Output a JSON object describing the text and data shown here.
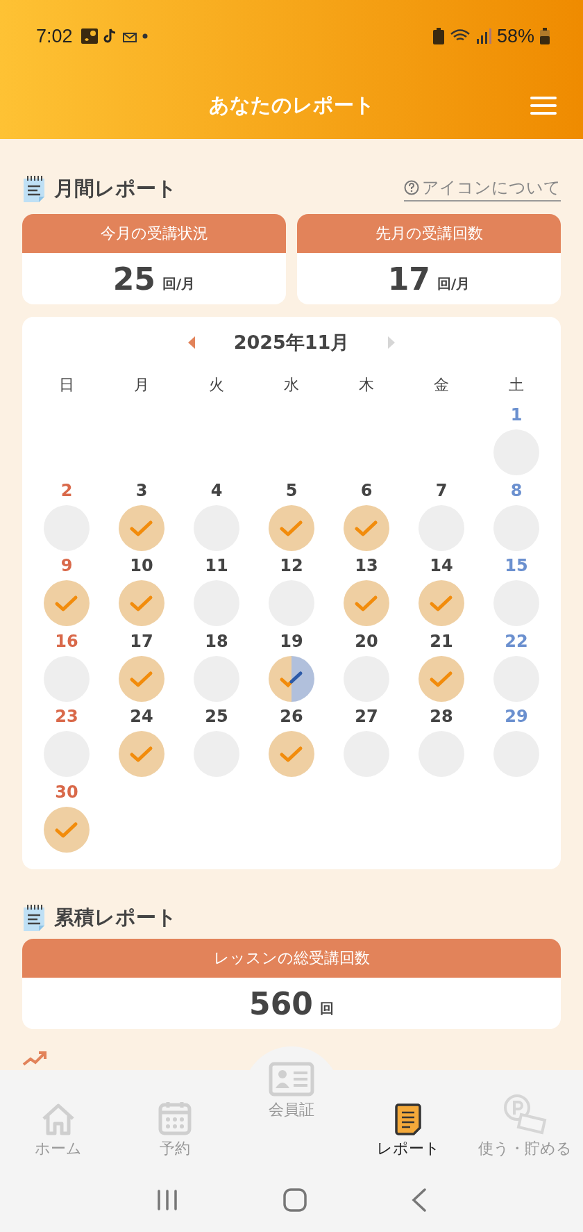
{
  "status_bar": {
    "time": "7:02",
    "battery": "58%"
  },
  "header": {
    "title": "あなたのレポート"
  },
  "monthly": {
    "title": "月間レポート",
    "help_link": "アイコンについて",
    "stats": [
      {
        "label": "今月の受講状況",
        "value": "25",
        "unit": "回/月"
      },
      {
        "label": "先月の受講回数",
        "value": "17",
        "unit": "回/月"
      }
    ]
  },
  "calendar": {
    "month": "2025年11月",
    "weekdays": [
      "日",
      "月",
      "火",
      "水",
      "木",
      "金",
      "土"
    ],
    "weeks": [
      [
        {
          "kind": "blank"
        },
        {
          "kind": "blank"
        },
        {
          "kind": "blank"
        },
        {
          "kind": "blank"
        },
        {
          "kind": "blank"
        },
        {
          "kind": "blank"
        },
        {
          "kind": "empty",
          "day": "1"
        }
      ],
      [
        {
          "kind": "empty",
          "day": "2"
        },
        {
          "kind": "attended",
          "day": "3"
        },
        {
          "kind": "empty",
          "day": "4"
        },
        {
          "kind": "attended",
          "day": "5"
        },
        {
          "kind": "attended",
          "day": "6"
        },
        {
          "kind": "empty",
          "day": "7"
        },
        {
          "kind": "empty",
          "day": "8"
        }
      ],
      [
        {
          "kind": "attended",
          "day": "9"
        },
        {
          "kind": "attended",
          "day": "10"
        },
        {
          "kind": "empty",
          "day": "11"
        },
        {
          "kind": "empty",
          "day": "12"
        },
        {
          "kind": "attended",
          "day": "13"
        },
        {
          "kind": "attended",
          "day": "14"
        },
        {
          "kind": "empty",
          "day": "15"
        }
      ],
      [
        {
          "kind": "empty",
          "day": "16"
        },
        {
          "kind": "attended",
          "day": "17"
        },
        {
          "kind": "empty",
          "day": "18"
        },
        {
          "kind": "split",
          "day": "19"
        },
        {
          "kind": "empty",
          "day": "20"
        },
        {
          "kind": "attended",
          "day": "21"
        },
        {
          "kind": "empty",
          "day": "22"
        }
      ],
      [
        {
          "kind": "empty",
          "day": "23"
        },
        {
          "kind": "attended",
          "day": "24"
        },
        {
          "kind": "empty",
          "day": "25"
        },
        {
          "kind": "attended",
          "day": "26"
        },
        {
          "kind": "empty",
          "day": "27"
        },
        {
          "kind": "empty",
          "day": "28"
        },
        {
          "kind": "empty",
          "day": "29"
        }
      ],
      [
        {
          "kind": "attended",
          "day": "30"
        }
      ]
    ]
  },
  "cumulative": {
    "title": "累積レポート",
    "stat": {
      "label": "レッスンの総受講回数",
      "value": "560",
      "unit": "回"
    }
  },
  "nav": [
    {
      "kind": "home",
      "label": "ホーム",
      "selected": false
    },
    {
      "kind": "calendar",
      "label": "予約",
      "selected": false
    },
    {
      "kind": "card",
      "label": "会員証",
      "selected": false
    },
    {
      "kind": "report",
      "label": "レポート",
      "selected": true
    },
    {
      "kind": "points",
      "label": "使う・貯める",
      "selected": false
    }
  ]
}
